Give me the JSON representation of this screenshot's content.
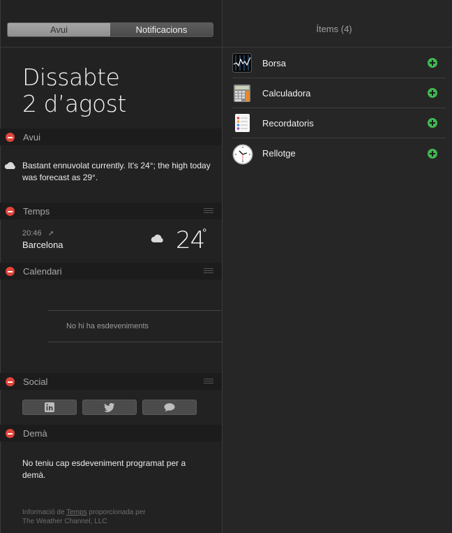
{
  "tabs": {
    "today": "Avui",
    "notifications": "Notificacions"
  },
  "date": {
    "weekday": "Dissabte",
    "day": "2 d’agost"
  },
  "sections": {
    "today": {
      "title": "Avui",
      "text": "Bastant ennuvolat currently. It's 24°; the high today was forecast as 29°."
    },
    "weather": {
      "title": "Temps",
      "time": "20:46",
      "city": "Barcelona",
      "temp": "24",
      "deg": "°"
    },
    "calendar": {
      "title": "Calendari",
      "empty": "No hi ha esdeveniments"
    },
    "social": {
      "title": "Social"
    },
    "tomorrow": {
      "title": "Demà",
      "text": "No teniu cap esdeveniment programat per a demà."
    }
  },
  "footer": {
    "pre": "Informació de ",
    "link": "Temps",
    "post": " proporcionada per",
    "line2": "The Weather Channel, LLC"
  },
  "items": {
    "title": "Ítems (4)",
    "list": [
      {
        "label": "Borsa",
        "icon": "stocks-icon"
      },
      {
        "label": "Calculadora",
        "icon": "calculator-icon"
      },
      {
        "label": "Recordatoris",
        "icon": "reminders-icon"
      },
      {
        "label": "Rellotge",
        "icon": "clock-icon"
      }
    ]
  },
  "colors": {
    "remove": "#e0443a",
    "add": "#3fb950"
  }
}
